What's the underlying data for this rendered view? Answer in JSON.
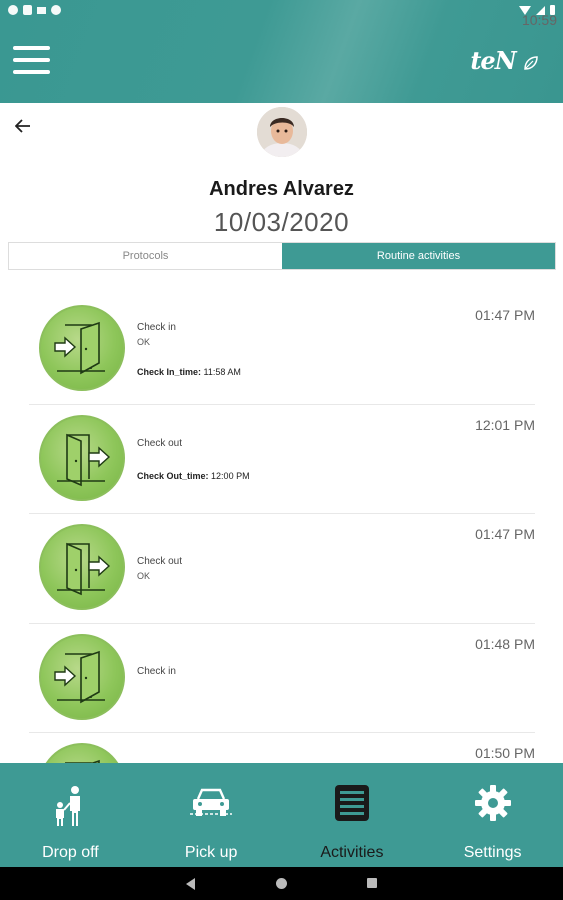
{
  "status_bar": {
    "time": "10:59"
  },
  "header": {
    "logo_text": "teN"
  },
  "profile": {
    "name": "Andres Alvarez",
    "date": "10/03/2020"
  },
  "tabs": [
    {
      "label": "Protocols",
      "active": false
    },
    {
      "label": "Routine activities",
      "active": true
    }
  ],
  "activities": [
    {
      "icon": "check-in-icon",
      "title": "Check in",
      "status": "OK",
      "detail_label": "Check In_time:",
      "detail_value": "11:58 AM",
      "time": "01:47 PM"
    },
    {
      "icon": "check-out-icon",
      "title": "Check out",
      "status": "",
      "detail_label": "Check Out_time:",
      "detail_value": "12:00 PM",
      "time": "12:01 PM"
    },
    {
      "icon": "check-out-icon",
      "title": "Check out",
      "status": "OK",
      "detail_label": "",
      "detail_value": "",
      "time": "01:47 PM"
    },
    {
      "icon": "check-in-icon",
      "title": "Check in",
      "status": "",
      "detail_label": "",
      "detail_value": "",
      "time": "01:48 PM"
    },
    {
      "icon": "check-in-icon",
      "title": "",
      "status": "",
      "detail_label": "",
      "detail_value": "",
      "time": "01:50 PM"
    }
  ],
  "bottom_nav": [
    {
      "label": "Drop off",
      "icon": "parent-child-icon",
      "active": false
    },
    {
      "label": "Pick up",
      "icon": "car-icon",
      "active": false
    },
    {
      "label": "Activities",
      "icon": "activities-list-icon",
      "active": true
    },
    {
      "label": "Settings",
      "icon": "gear-icon",
      "active": false
    }
  ],
  "colors": {
    "primary": "#3e9a94",
    "activity_circle": "#8ec65a",
    "system_bar": "#000000"
  }
}
